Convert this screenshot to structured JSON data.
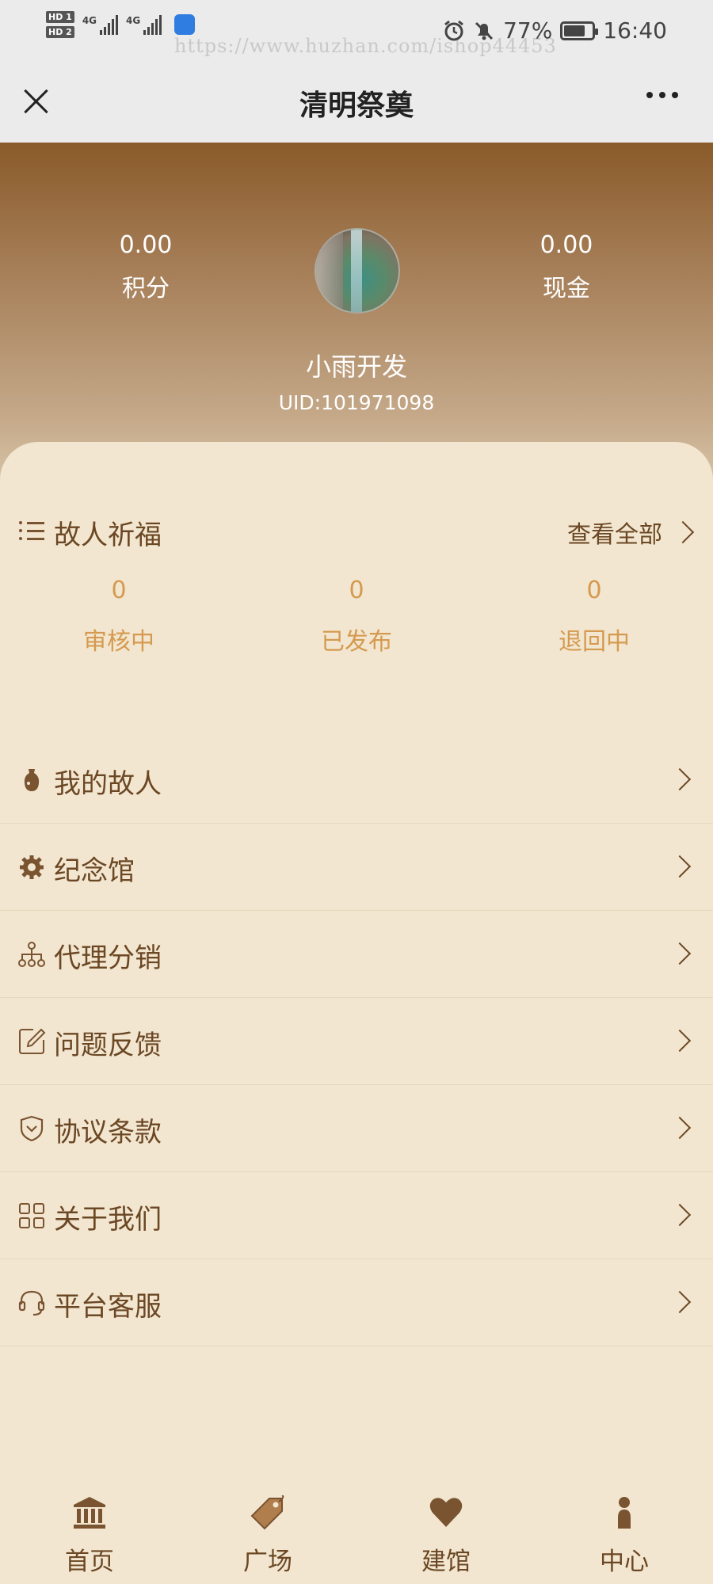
{
  "status_bar": {
    "hd1": "HD 1",
    "hd2": "HD 2",
    "signal1_label": "4G",
    "signal2_label": "4G",
    "watermark": "https://www.huzhan.com/ishop44453",
    "battery": "77%",
    "battery_level": 0.77,
    "time": "16:40",
    "icons": [
      "alarm-icon",
      "mute-bell-icon",
      "battery-icon"
    ]
  },
  "nav": {
    "title": "清明祭奠"
  },
  "header": {
    "points_value": "0.00",
    "points_label": "积分",
    "cash_value": "0.00",
    "cash_label": "现金",
    "user_name": "小雨开发",
    "uid": "UID:101971098"
  },
  "prayers": {
    "title": "故人祈福",
    "view_all": "查看全部",
    "counts": [
      {
        "value": "0",
        "label": "审核中"
      },
      {
        "value": "0",
        "label": "已发布"
      },
      {
        "value": "0",
        "label": "退回中"
      }
    ]
  },
  "menu": [
    {
      "label": "我的故人",
      "icon": "urn-icon"
    },
    {
      "label": "纪念馆",
      "icon": "gear-icon"
    },
    {
      "label": "代理分销",
      "icon": "network-icon"
    },
    {
      "label": "问题反馈",
      "icon": "edit-icon"
    },
    {
      "label": "协议条款",
      "icon": "shield-icon"
    },
    {
      "label": "关于我们",
      "icon": "grid-icon"
    },
    {
      "label": "平台客服",
      "icon": "headset-icon"
    }
  ],
  "tabs": [
    {
      "label": "首页",
      "icon": "temple-icon"
    },
    {
      "label": "广场",
      "icon": "tag-icon"
    },
    {
      "label": "建馆",
      "icon": "heart-icon"
    },
    {
      "label": "中心",
      "icon": "person-icon"
    }
  ],
  "colors": {
    "accent": "#6b4724",
    "count": "#d59a4f",
    "background": "#f2e6d0",
    "header_top": "#8a5b2a"
  }
}
